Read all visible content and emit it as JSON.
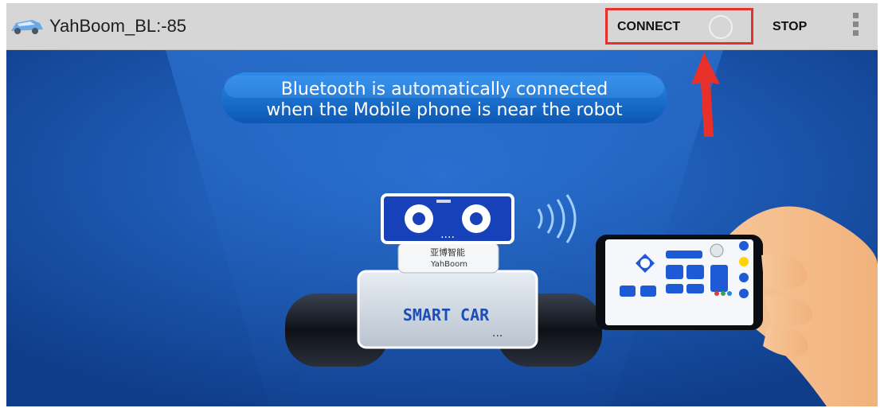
{
  "appbar": {
    "title": "YahBoom_BL:-85",
    "connect_label": "CONNECT",
    "stop_label": "STOP",
    "icon": "robot-car-icon",
    "menu_icon": "more-vert-icon"
  },
  "banner": {
    "line1": "Bluetooth is automatically connected",
    "line2": "when the Mobile phone is near the robot",
    "brand_cn": "亚博智能",
    "brand_en": "YahBoom",
    "car_label": "SMART CAR",
    "dots": "..."
  },
  "annotation": {
    "highlight_color": "#e8302b"
  },
  "colors": {
    "appbar": "#d6d6d6",
    "banner": "#1b53a6",
    "accent": "#e8302b"
  }
}
